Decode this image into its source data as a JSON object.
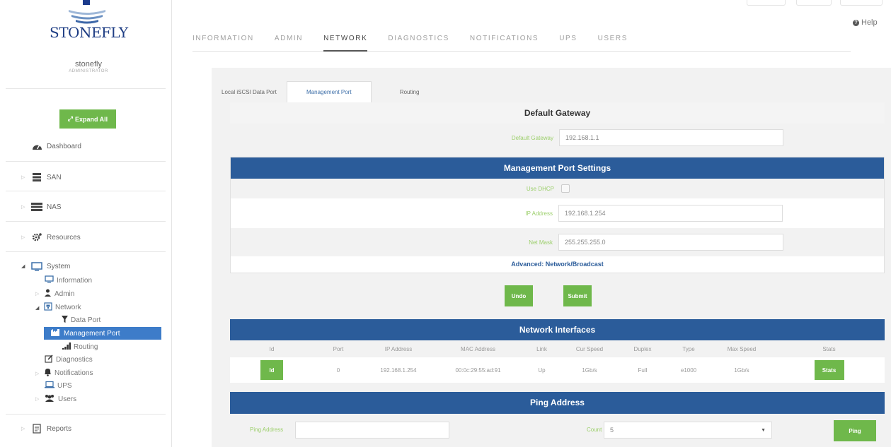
{
  "brand": {
    "name": "STONEFLY",
    "user_name": "stonefly",
    "user_role": "ADMINISTRATOR"
  },
  "sidebar": {
    "expand_all": "Expand All",
    "dashboard": "Dashboard",
    "san": "SAN",
    "nas": "NAS",
    "resources": "Resources",
    "system": "System",
    "information": "Information",
    "admin": "Admin",
    "network": "Network",
    "data_port": "Data Port",
    "management_port": "Management Port",
    "routing": "Routing",
    "diagnostics": "Diagnostics",
    "notifications": "Notifications",
    "ups": "UPS",
    "users": "Users",
    "reports": "Reports"
  },
  "help": "Help",
  "main_tabs": [
    "INFORMATION",
    "ADMIN",
    "NETWORK",
    "DIAGNOSTICS",
    "NOTIFICATIONS",
    "UPS",
    "USERS"
  ],
  "sub_tabs": [
    "Local iSCSI Data Port",
    "Management Port",
    "Routing"
  ],
  "gateway": {
    "title": "Default Gateway",
    "label": "Default Gateway",
    "value": "192.168.1.1"
  },
  "mgmt": {
    "title": "Management Port Settings",
    "use_dhcp_label": "Use DHCP",
    "ip_label": "IP Address",
    "ip_value": "192.168.1.254",
    "netmask_label": "Net Mask",
    "netmask_value": "255.255.255.0",
    "advanced": "Advanced: Network/Broadcast"
  },
  "buttons": {
    "undo": "Undo",
    "submit": "Submit"
  },
  "interfaces": {
    "title": "Network Interfaces",
    "columns": [
      "Id",
      "Port",
      "IP Address",
      "MAC Address",
      "Link",
      "Cur Speed",
      "Duplex",
      "Type",
      "Max Speed",
      "Stats"
    ],
    "row": {
      "id": "Id",
      "port": "0",
      "ip": "192.168.1.254",
      "mac": "00:0c:29:55:ad:91",
      "link": "Up",
      "cur_speed": "1Gb/s",
      "duplex": "Full",
      "type": "e1000",
      "max_speed": "1Gb/s",
      "stats": "Stats"
    }
  },
  "ping": {
    "title": "Ping Address",
    "address_label": "Ping Address",
    "address_value": "",
    "count_label": "Count",
    "count_value": "5",
    "button": "Ping"
  },
  "colors": {
    "accent_green": "#6fb84b",
    "header_blue": "#2b5c9a",
    "active_blue": "#3d7cc9"
  }
}
